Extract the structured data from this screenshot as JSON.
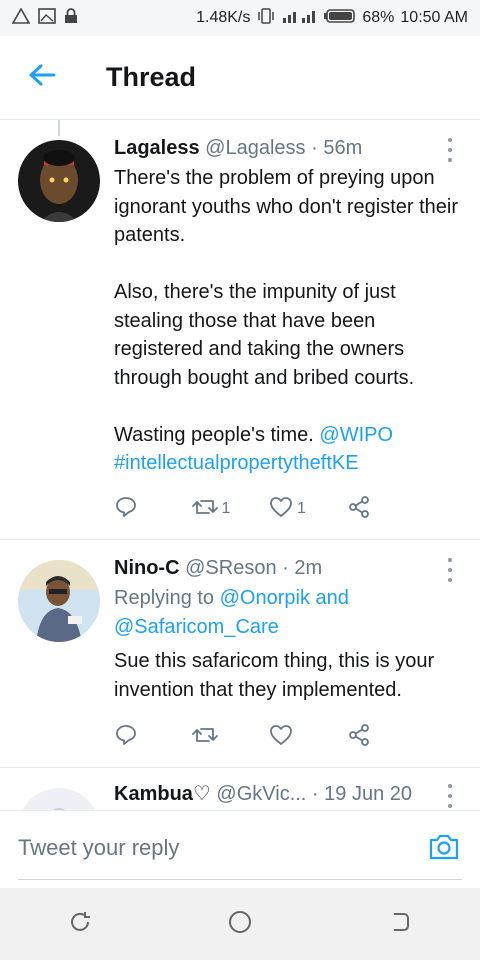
{
  "status_bar": {
    "speed": "1.48K/s",
    "battery": "68%",
    "time": "10:50 AM",
    "icons": [
      "warning-icon",
      "image-icon",
      "lock-icon",
      "vibrate-icon",
      "signal-icon",
      "battery-icon"
    ]
  },
  "header": {
    "title": "Thread",
    "back_icon": "arrow-left-icon"
  },
  "tweets": [
    {
      "name": "Lagaless",
      "handle": "@Lagaless",
      "time": "· 56m",
      "text_1": "There's the problem of preying upon ignorant youths who don't register their patents.\n\nAlso, there's the impunity of just stealing those that have been registered and taking the owners through bought and bribed courts.\n\nWasting people's time. ",
      "mention": "@WIPO",
      "hashtag": "#intellectualpropertytheftKE",
      "retweets": "1",
      "likes": "1"
    },
    {
      "name": "Nino-C",
      "handle": "@SReson",
      "time": "· 2m",
      "replying_prefix": "Replying to ",
      "replying_to": "@Onorpik and @Safaricom_Care",
      "text_1": "Sue this safaricom thing, this is your invention that they implemented.",
      "retweets": "",
      "likes": ""
    },
    {
      "name": "Kambua♡",
      "handle": "@GkVic...",
      "time": "· 19 Jun 20"
    }
  ],
  "reply_bar": {
    "placeholder": "Tweet your reply",
    "camera_icon": "camera-icon"
  },
  "colors": {
    "accent": "#1da1f2",
    "text": "#14171a",
    "muted": "#657786",
    "divider": "#e6ecf0"
  }
}
